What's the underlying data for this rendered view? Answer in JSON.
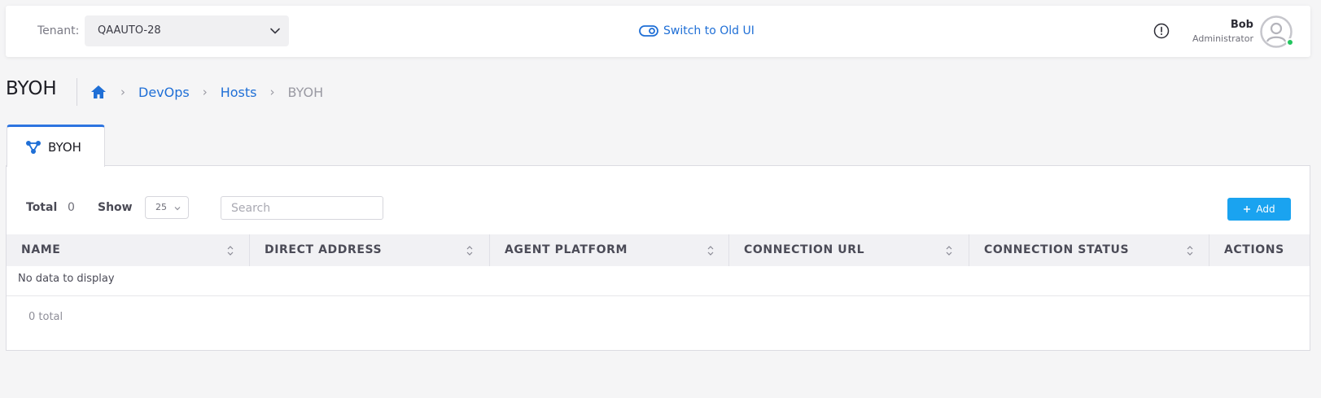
{
  "header": {
    "tenant_label": "Tenant:",
    "tenant_value": "QAAUTO-28",
    "switch_ui_label": "Switch to Old UI",
    "user_name": "Bob",
    "user_role": "Administrator"
  },
  "page": {
    "title": "BYOH",
    "breadcrumb": [
      "DevOps",
      "Hosts",
      "BYOH"
    ]
  },
  "tabs": [
    {
      "label": "BYOH",
      "active": true
    }
  ],
  "toolbar": {
    "total_label": "Total",
    "total_value": "0",
    "show_label": "Show",
    "show_value": "25",
    "search_placeholder": "Search",
    "add_label": "Add"
  },
  "table": {
    "columns": [
      "NAME",
      "DIRECT ADDRESS",
      "AGENT PLATFORM",
      "CONNECTION URL",
      "CONNECTION STATUS",
      "ACTIONS"
    ],
    "empty_message": "No data to display",
    "footer_total": "0 total"
  },
  "colors": {
    "accent": "#1f6fd6",
    "add_button": "#1aa3f0",
    "online_status": "#22c55e"
  },
  "icons": {
    "tenant_chevron": "chevron-down-icon",
    "switch_ui": "toggle-icon",
    "alert": "alert-circle-icon",
    "avatar": "user-avatar-icon",
    "home": "home-icon",
    "tab": "nodes-icon",
    "sort": "sort-icon",
    "add": "plus-icon"
  }
}
